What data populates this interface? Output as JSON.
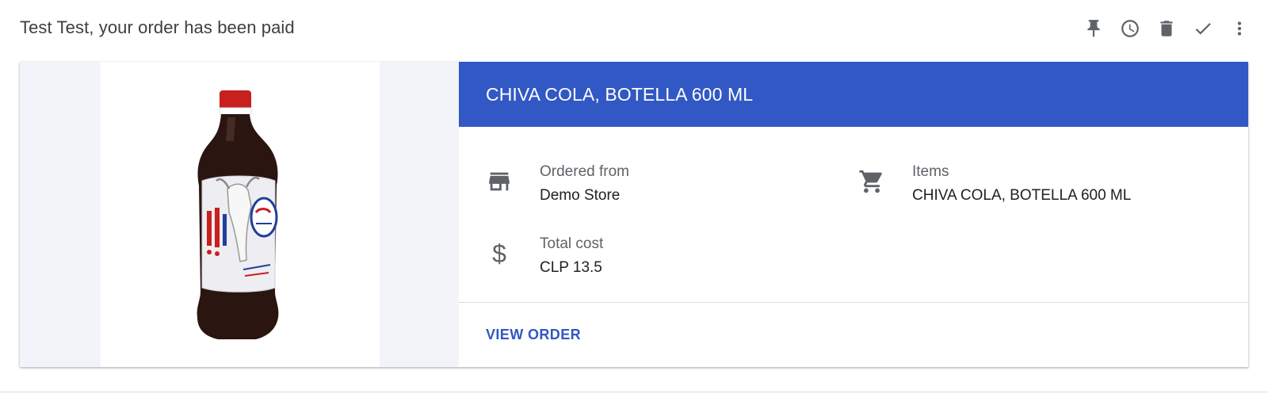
{
  "header": {
    "subject": "Test Test, your order has been paid",
    "actions": [
      {
        "name": "pin-icon"
      },
      {
        "name": "snooze-clock-icon"
      },
      {
        "name": "delete-trash-icon"
      },
      {
        "name": "mark-done-check-icon"
      },
      {
        "name": "more-vert-icon"
      }
    ]
  },
  "order": {
    "title": "CHIVA COLA, BOTELLA 600 ML",
    "ordered_from_label": "Ordered from",
    "ordered_from_value": "Demo Store",
    "items_label": "Items",
    "items_value": "CHIVA COLA, BOTELLA 600 ML",
    "total_cost_label": "Total cost",
    "total_cost_value": "CLP 13.5",
    "dollar_symbol": "$",
    "view_order_label": "VIEW ORDER",
    "product_image": "cola-bottle-image"
  },
  "colors": {
    "accent": "#3158c4",
    "icon_gray": "#5f6368",
    "media_background": "#f3f4fa"
  }
}
